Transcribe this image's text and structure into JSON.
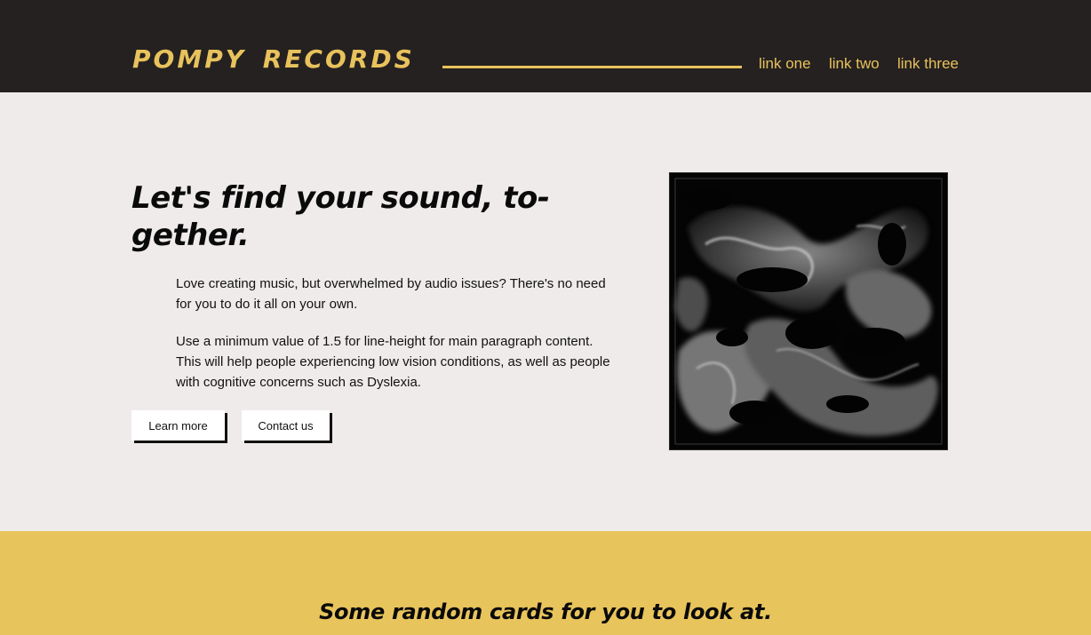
{
  "header": {
    "brand": "POMPY RECORDS",
    "nav": [
      {
        "label": "link one"
      },
      {
        "label": "link two"
      },
      {
        "label": "link three"
      }
    ]
  },
  "hero": {
    "title": "Let's find your sound, to-gether.",
    "paragraphs": [
      "Love creating music, but overwhelmed by audio issues? There's no need for you to do it all on your own.",
      "Use a minimum value of 1.5 for line-height for main paragraph content. This will help people experiencing low vision conditions, as well as people with cognitive concerns such as Dyslexia."
    ],
    "buttons": {
      "learn_more": "Learn more",
      "contact_us": "Contact us"
    }
  },
  "cards_section": {
    "title": "Some random cards for you to look at."
  },
  "colors": {
    "header_bg": "#252120",
    "accent_gold": "#e8c25c",
    "page_bg": "#efebea",
    "band_bg": "#e8c45c"
  }
}
